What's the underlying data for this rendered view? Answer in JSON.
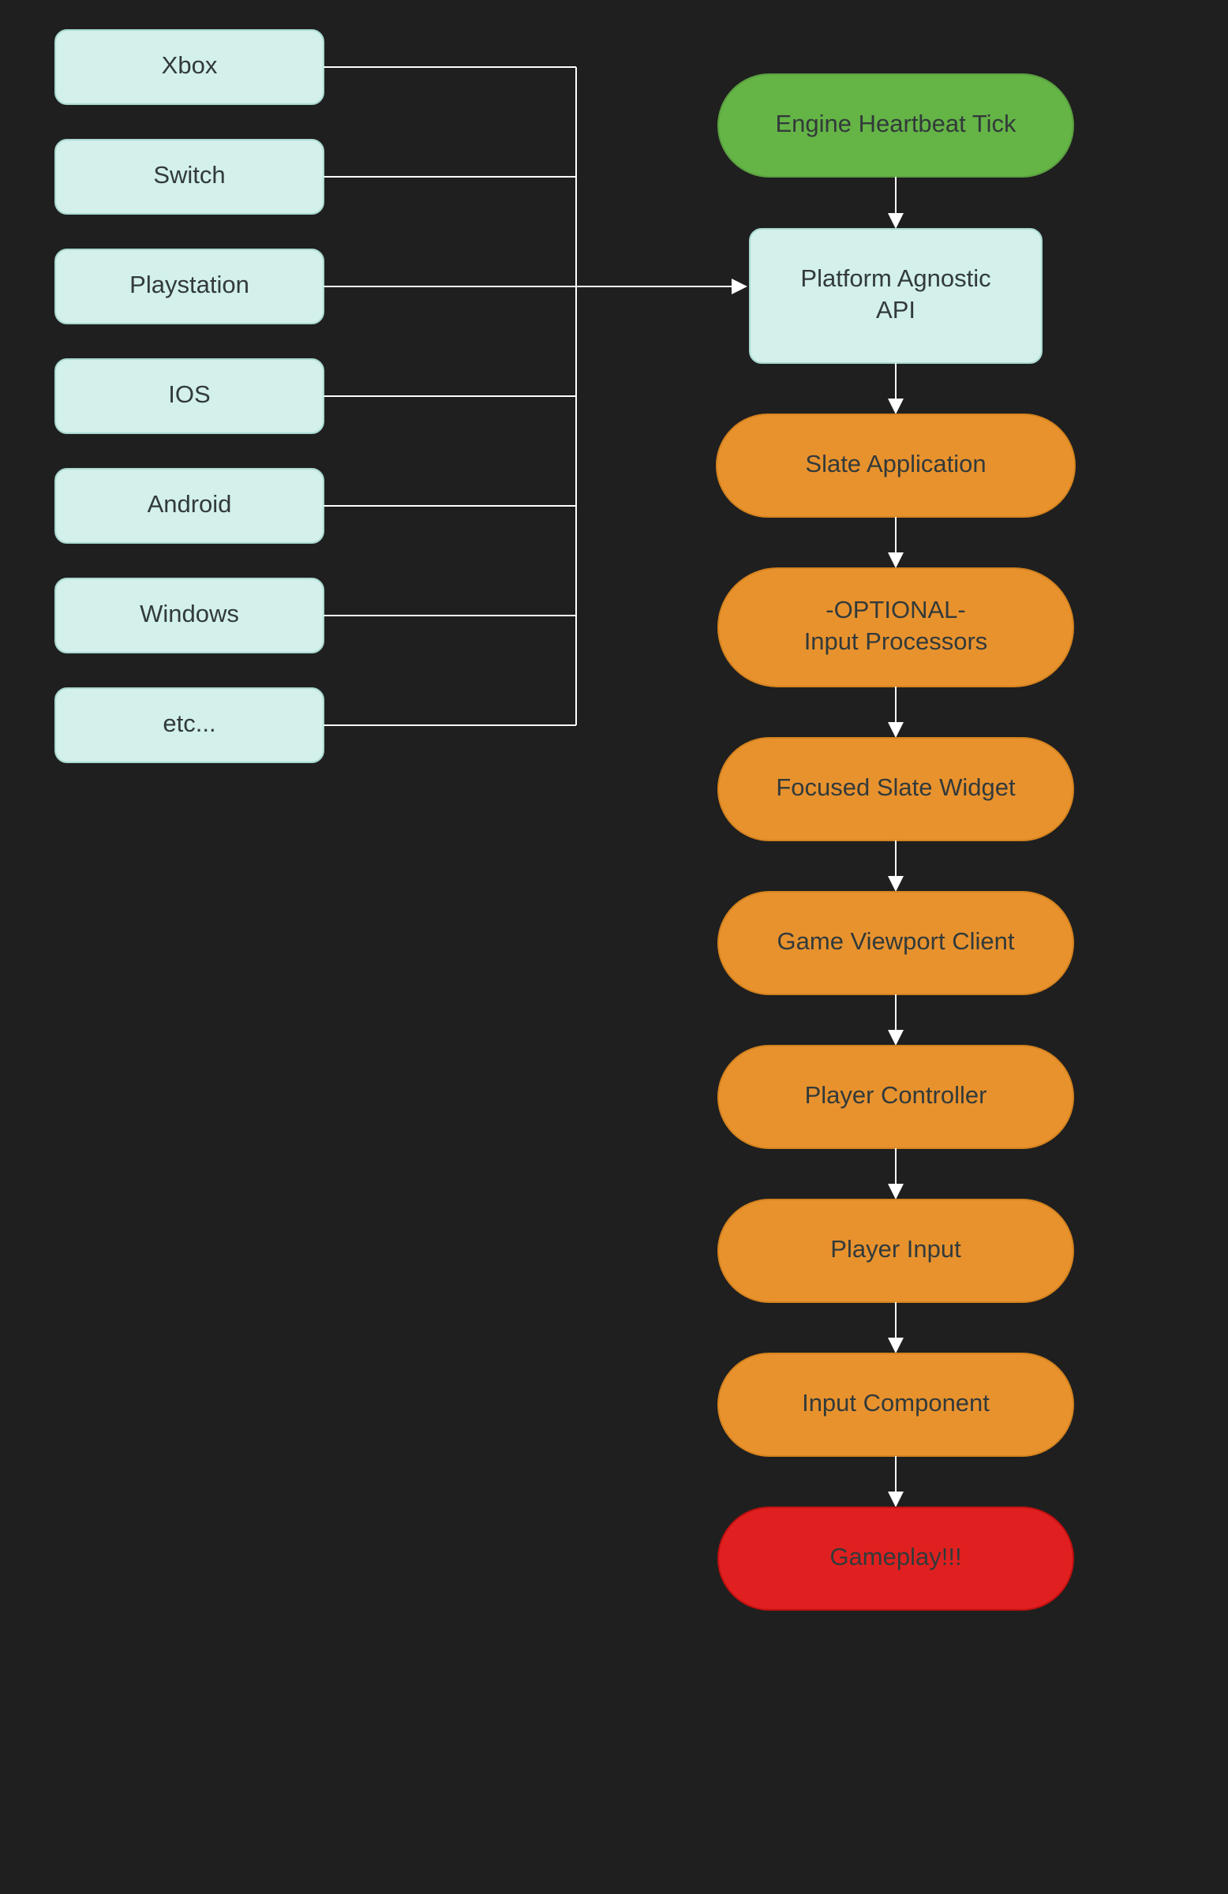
{
  "platforms": [
    {
      "label": "Xbox"
    },
    {
      "label": "Switch"
    },
    {
      "label": "Playstation"
    },
    {
      "label": "IOS"
    },
    {
      "label": "Android"
    },
    {
      "label": "Windows"
    },
    {
      "label": "etc..."
    }
  ],
  "pipeline": {
    "tick": "Engine Heartbeat Tick",
    "api_line1": "Platform Agnostic",
    "api_line2": "API",
    "slate_app": "Slate Application",
    "processors_line1": "-OPTIONAL-",
    "processors_line2": "Input Processors",
    "focused": "Focused Slate Widget",
    "viewport": "Game Viewport Client",
    "controller": "Player Controller",
    "player_input": "Player Input",
    "component": "Input Component",
    "gameplay": "Gameplay!!!"
  },
  "colors": {
    "bg": "#1f1f1f",
    "mint": "#d3f0eb",
    "green": "#64b446",
    "orange": "#e8922e",
    "red": "#e02020",
    "text": "#323a3a",
    "line": "#ffffff"
  }
}
